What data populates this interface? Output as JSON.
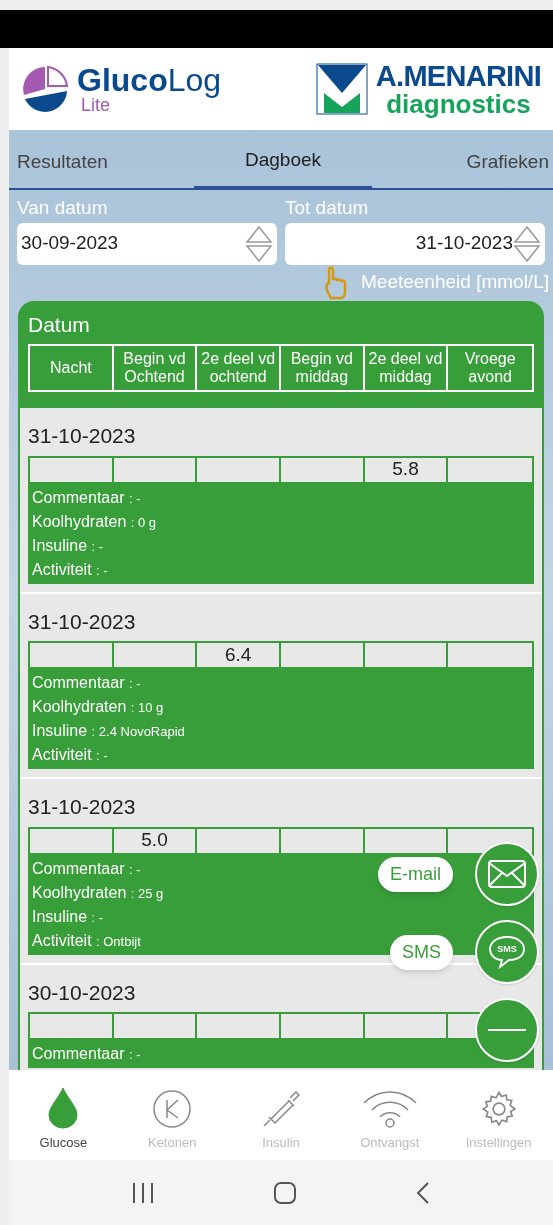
{
  "header": {
    "app_logo": {
      "bold": "Gluco",
      "light": "Log",
      "sub": "Lite"
    },
    "brand_logo": {
      "name": "A.MENARINI",
      "sub": "diagnostics"
    }
  },
  "tabs": [
    {
      "label": "Resultaten",
      "selected": false
    },
    {
      "label": "Dagboek",
      "selected": true
    },
    {
      "label": "Grafieken",
      "selected": false
    }
  ],
  "date_from": {
    "label": "Van datum",
    "value": "30-09-2023"
  },
  "date_to": {
    "label": "Tot datum",
    "value": "31-10-2023"
  },
  "unit": "Meeteenheid [mmol/L]",
  "table": {
    "title": "Datum",
    "columns": [
      "Nacht",
      "Begin vd Ochtend",
      "2e deel vd ochtend",
      "Begin vd middag",
      "2e deel vd middag",
      "Vroege avond"
    ],
    "entries": [
      {
        "date": "31-10-2023",
        "readings": {
          "column_5": "5.8"
        },
        "details": [
          {
            "label": "Commentaar",
            "value": ": -"
          },
          {
            "label": "Koolhydraten",
            "value": ": 0 g"
          },
          {
            "label": "Insuline",
            "value": ": -"
          },
          {
            "label": "Activiteit",
            "value": ": -"
          }
        ]
      },
      {
        "date": "31-10-2023",
        "readings": {
          "column_3": "6.4"
        },
        "details": [
          {
            "label": "Commentaar",
            "value": ": -"
          },
          {
            "label": "Koolhydraten",
            "value": ": 10 g"
          },
          {
            "label": "Insuline",
            "value": ": 2.4 NovoRapid"
          },
          {
            "label": "Activiteit",
            "value": ": -"
          }
        ]
      },
      {
        "date": "31-10-2023",
        "readings": {
          "column_2": "5.0"
        },
        "details": [
          {
            "label": "Commentaar",
            "value": ": -"
          },
          {
            "label": "Koolhydraten",
            "value": ": 25 g"
          },
          {
            "label": "Insuline",
            "value": ": -"
          },
          {
            "label": "Activiteit",
            "value": ": Ontbijt"
          }
        ]
      },
      {
        "date": "30-10-2023",
        "details": [
          {
            "label": "Commentaar",
            "value": ": -"
          }
        ]
      }
    ]
  },
  "share_actions": [
    {
      "kind": "email",
      "label": "E-mail"
    },
    {
      "kind": "sms",
      "label": "SMS",
      "icon_text": "SMS"
    }
  ],
  "bottom_nav": [
    {
      "kind": "drop",
      "label": "Glucose",
      "selected": true
    },
    {
      "kind": "ketone",
      "label": "Ketonen",
      "selected": false
    },
    {
      "kind": "syringe",
      "label": "Insulin",
      "selected": false
    },
    {
      "kind": "wireless",
      "label": "Ontvangst",
      "selected": false
    },
    {
      "kind": "gear",
      "label": "Instellingen",
      "selected": false
    }
  ]
}
